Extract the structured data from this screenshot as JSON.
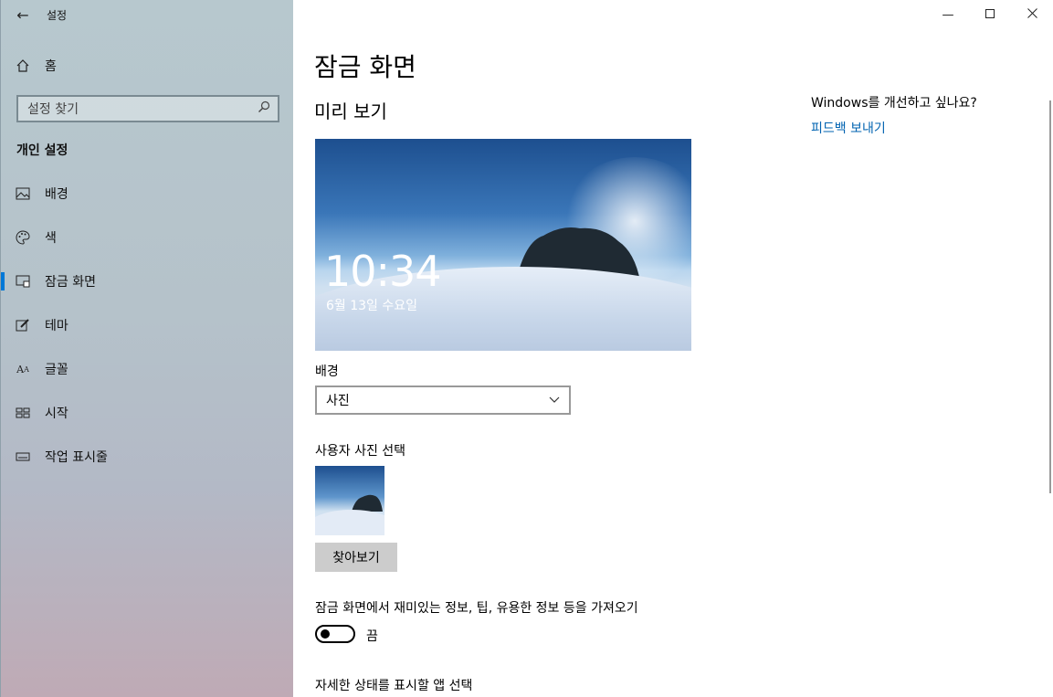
{
  "app": {
    "title": "설정"
  },
  "sidebar": {
    "home": "홈",
    "search_placeholder": "설정 찾기",
    "section_title": "개인 설정",
    "items": [
      {
        "label": "배경",
        "icon": "picture-icon"
      },
      {
        "label": "색",
        "icon": "palette-icon"
      },
      {
        "label": "잠금 화면",
        "icon": "lock-screen-icon",
        "active": true
      },
      {
        "label": "테마",
        "icon": "theme-brush-icon"
      },
      {
        "label": "글꼴",
        "icon": "font-icon"
      },
      {
        "label": "시작",
        "icon": "start-icon"
      },
      {
        "label": "작업 표시줄",
        "icon": "taskbar-icon"
      }
    ]
  },
  "main": {
    "title": "잠금 화면",
    "preview_heading": "미리 보기",
    "preview": {
      "time": "10:34",
      "date": "6월 13일 수요일"
    },
    "background_label": "배경",
    "background_value": "사진",
    "choose_photo_label": "사용자 사진 선택",
    "browse_button": "찾아보기",
    "fun_facts_label": "잠금 화면에서 재미있는 정보, 팁, 유용한 정보 등을 가져오기",
    "fun_facts_state": "끔",
    "fun_facts_on": false,
    "detailed_status_label": "자세한 상태를 표시할 앱 선택"
  },
  "aside": {
    "question": "Windows를 개선하고 싶나요?",
    "feedback_link": "피드백 보내기"
  },
  "colors": {
    "accent": "#0078d7",
    "link": "#0063b1"
  }
}
